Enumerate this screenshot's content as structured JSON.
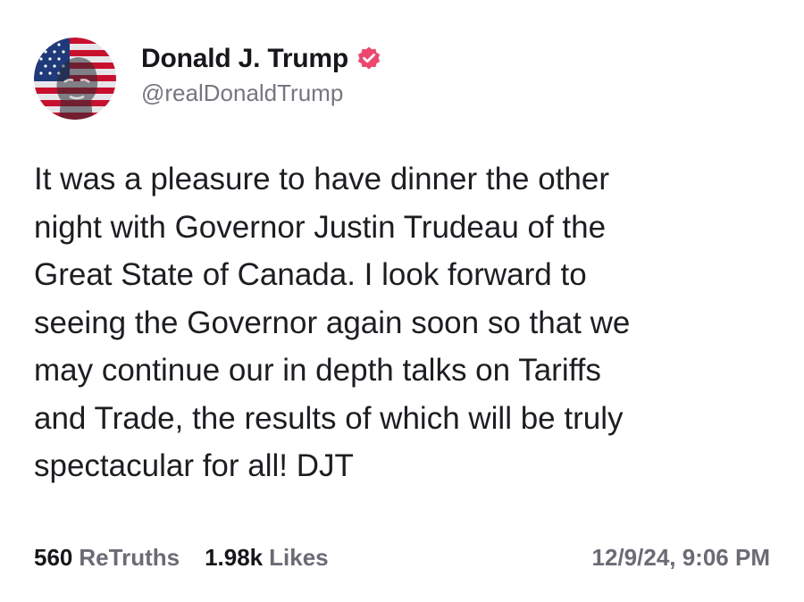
{
  "author": {
    "display_name": "Donald J. Trump",
    "handle": "@realDonaldTrump",
    "verified_icon": "verified-badge-icon",
    "verified_color": "#f0466e"
  },
  "post": {
    "text": "It was a pleasure to have dinner the other\nnight with Governor Justin Trudeau of the\nGreat State of Canada. I look forward to\nseeing the Governor again soon so that we\nmay continue our in depth talks on Tariffs\nand Trade, the results of which will be truly\nspectacular for all! DJT"
  },
  "stats": {
    "retruths_count": "560",
    "retruths_label": "ReTruths",
    "likes_count": "1.98k",
    "likes_label": "Likes"
  },
  "timestamp": "12/9/24, 9:06 PM"
}
